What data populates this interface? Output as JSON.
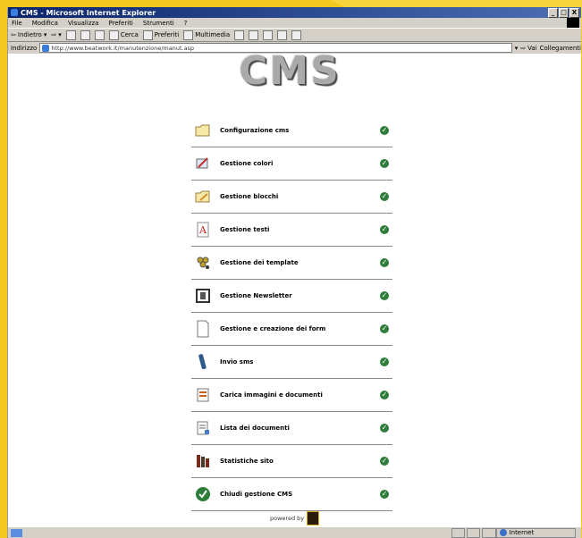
{
  "window": {
    "title": "CMS - Microsoft Internet Explorer",
    "controls": [
      "_",
      "□",
      "X"
    ]
  },
  "menubar": [
    "File",
    "Modifica",
    "Visualizza",
    "Preferiti",
    "Strumenti",
    "?"
  ],
  "toolbar": {
    "back": "Indietro",
    "search": "Cerca",
    "favorites": "Preferiti",
    "multimedia": "Multimedia"
  },
  "address": {
    "label": "Indirizzo",
    "url": "http://www.beatwork.it/manutenzione/manut.asp",
    "go": "Vai",
    "links": "Collegamenti"
  },
  "page": {
    "logo": "CMS",
    "items": [
      {
        "label": "Configurazione cms",
        "icon": "folder-icon"
      },
      {
        "label": "Gestione colori",
        "icon": "palette-icon"
      },
      {
        "label": "Gestione blocchi",
        "icon": "folder-pencil-icon"
      },
      {
        "label": "Gestione testi",
        "icon": "text-doc-icon"
      },
      {
        "label": "Gestione dei template",
        "icon": "template-icon"
      },
      {
        "label": "Gestione Newsletter",
        "icon": "newsletter-icon"
      },
      {
        "label": "Gestione e creazione dei form",
        "icon": "form-icon"
      },
      {
        "label": "Invio sms",
        "icon": "phone-icon"
      },
      {
        "label": "Carica immagini e documenti",
        "icon": "upload-icon"
      },
      {
        "label": "Lista dei documenti",
        "icon": "doc-list-icon"
      },
      {
        "label": "Statistiche sito",
        "icon": "stats-icon"
      },
      {
        "label": "Chiudi gestione CMS",
        "icon": "close-check-icon"
      }
    ],
    "powered_by": "powered by"
  },
  "status": {
    "zone": "Internet"
  }
}
